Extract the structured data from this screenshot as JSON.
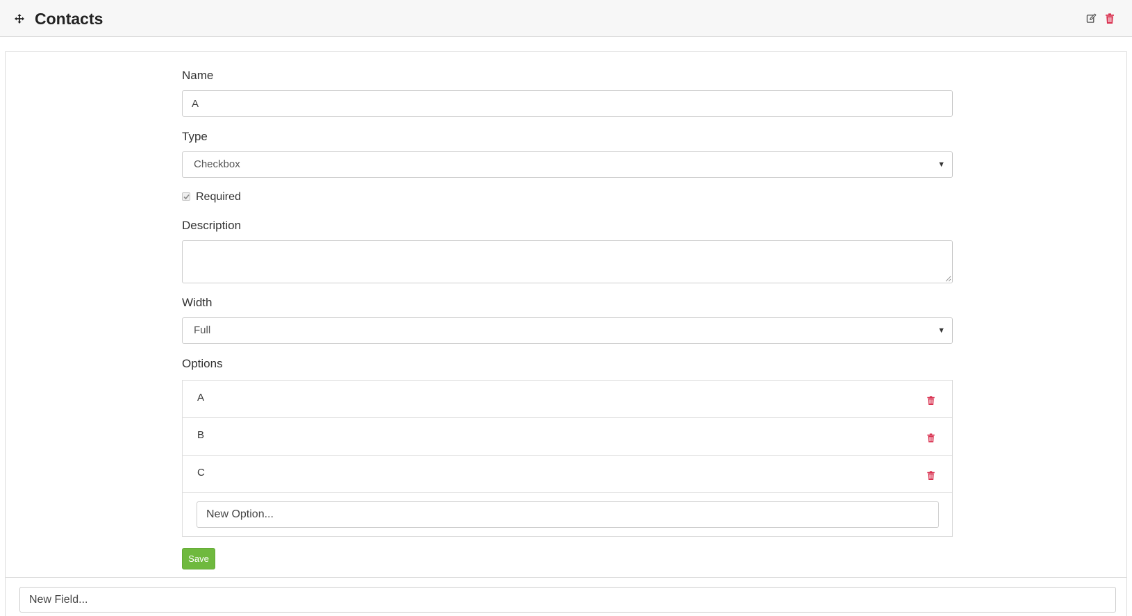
{
  "header": {
    "title": "Contacts",
    "move_icon": "move-arrows-icon",
    "edit_icon": "edit-icon",
    "delete_icon": "trash-icon"
  },
  "form": {
    "name": {
      "label": "Name",
      "value": "A"
    },
    "type": {
      "label": "Type",
      "selected": "Checkbox"
    },
    "required": {
      "label": "Required",
      "checked": true
    },
    "description": {
      "label": "Description",
      "value": ""
    },
    "width": {
      "label": "Width",
      "selected": "Full"
    },
    "options": {
      "label": "Options",
      "items": [
        {
          "label": "A"
        },
        {
          "label": "B"
        },
        {
          "label": "C"
        }
      ],
      "new_option_placeholder": "New Option..."
    },
    "save_label": "Save"
  },
  "footer": {
    "new_field_placeholder": "New Field..."
  },
  "colors": {
    "accent_green": "#6fb93e",
    "danger_red": "#d9304f",
    "header_bg": "#f7f7f7",
    "border": "#dddddd"
  }
}
